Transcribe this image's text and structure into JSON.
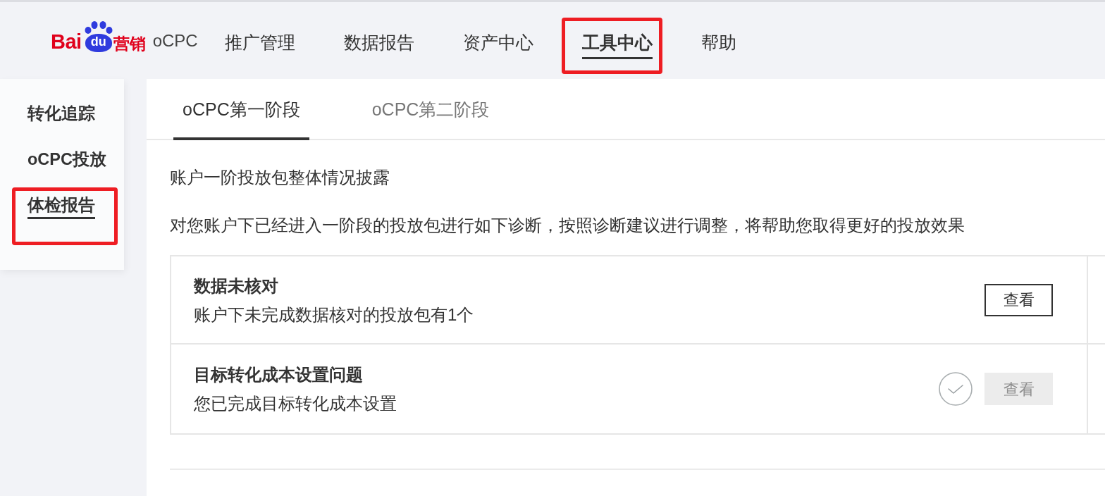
{
  "header": {
    "logo": {
      "wordmark": "Bai",
      "paw_text": "du",
      "suffix": "营销"
    },
    "product": "oCPC",
    "nav": [
      {
        "label": "推广管理",
        "selected": false,
        "highlighted": false
      },
      {
        "label": "数据报告",
        "selected": false,
        "highlighted": false
      },
      {
        "label": "资产中心",
        "selected": false,
        "highlighted": false
      },
      {
        "label": "工具中心",
        "selected": true,
        "highlighted": true
      },
      {
        "label": "帮助",
        "selected": false,
        "highlighted": false
      }
    ]
  },
  "sidebar": {
    "items": [
      {
        "label": "转化追踪",
        "selected": false,
        "highlighted": false
      },
      {
        "label": "oCPC投放",
        "selected": false,
        "highlighted": false
      },
      {
        "label": "体检报告",
        "selected": true,
        "highlighted": true
      }
    ]
  },
  "tabs": [
    {
      "label": "oCPC第一阶段",
      "selected": true
    },
    {
      "label": "oCPC第二阶段",
      "selected": false
    }
  ],
  "section": {
    "title": "账户一阶投放包整体情况披露",
    "description": "对您账户下已经进入一阶段的投放包进行如下诊断，按照诊断建议进行调整，将帮助您取得更好的投放效果"
  },
  "checks": [
    {
      "title": "数据未核对",
      "detail": "账户下未完成数据核对的投放包有1个",
      "done": false,
      "button": {
        "label": "查看",
        "disabled": false
      }
    },
    {
      "title": "目标转化成本设置问题",
      "detail": "您已完成目标转化成本设置",
      "done": true,
      "button": {
        "label": "查看",
        "disabled": true
      }
    }
  ]
}
